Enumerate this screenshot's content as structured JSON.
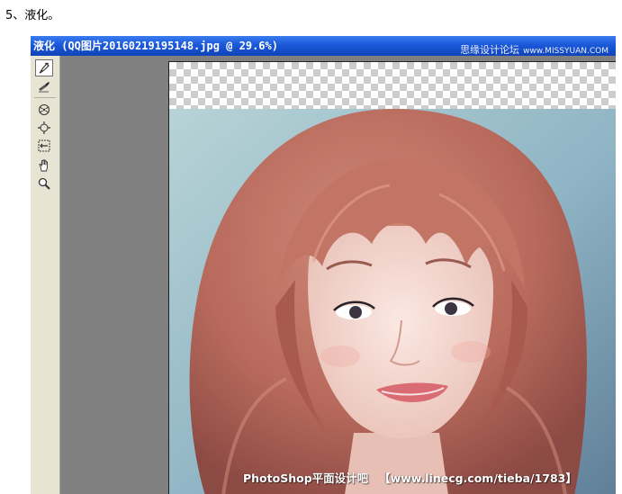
{
  "step_heading": "5、液化。",
  "window": {
    "title": "液化 (QQ图片20160219195148.jpg @ 29.6%)",
    "watermark_top": {
      "brand": "思缘设计论坛",
      "url": "www.MISSYUAN.COM"
    }
  },
  "toolbox": {
    "tools": [
      {
        "name": "forward-warp-tool",
        "icon": "finger-brush-icon",
        "active": true
      },
      {
        "name": "reconstruct-tool",
        "icon": "reconstruct-brush-icon",
        "active": false
      },
      {
        "name": "pucker-tool",
        "icon": "pucker-icon",
        "active": false
      },
      {
        "name": "bloat-tool",
        "icon": "bloat-icon",
        "active": false
      },
      {
        "name": "push-left-tool",
        "icon": "push-left-icon",
        "active": false
      },
      {
        "name": "hand-tool",
        "icon": "hand-icon",
        "active": false
      },
      {
        "name": "zoom-tool",
        "icon": "magnifier-icon",
        "active": false
      }
    ]
  },
  "canvas": {
    "image_description_colors": {
      "hair": "#b86a5c",
      "skin": "#f2d8d0",
      "background": "#8fb4c4"
    },
    "watermark_bottom": {
      "site": "PhotoShop平面设计吧",
      "url": "【www.linecg.com/tieba/1783】"
    }
  }
}
